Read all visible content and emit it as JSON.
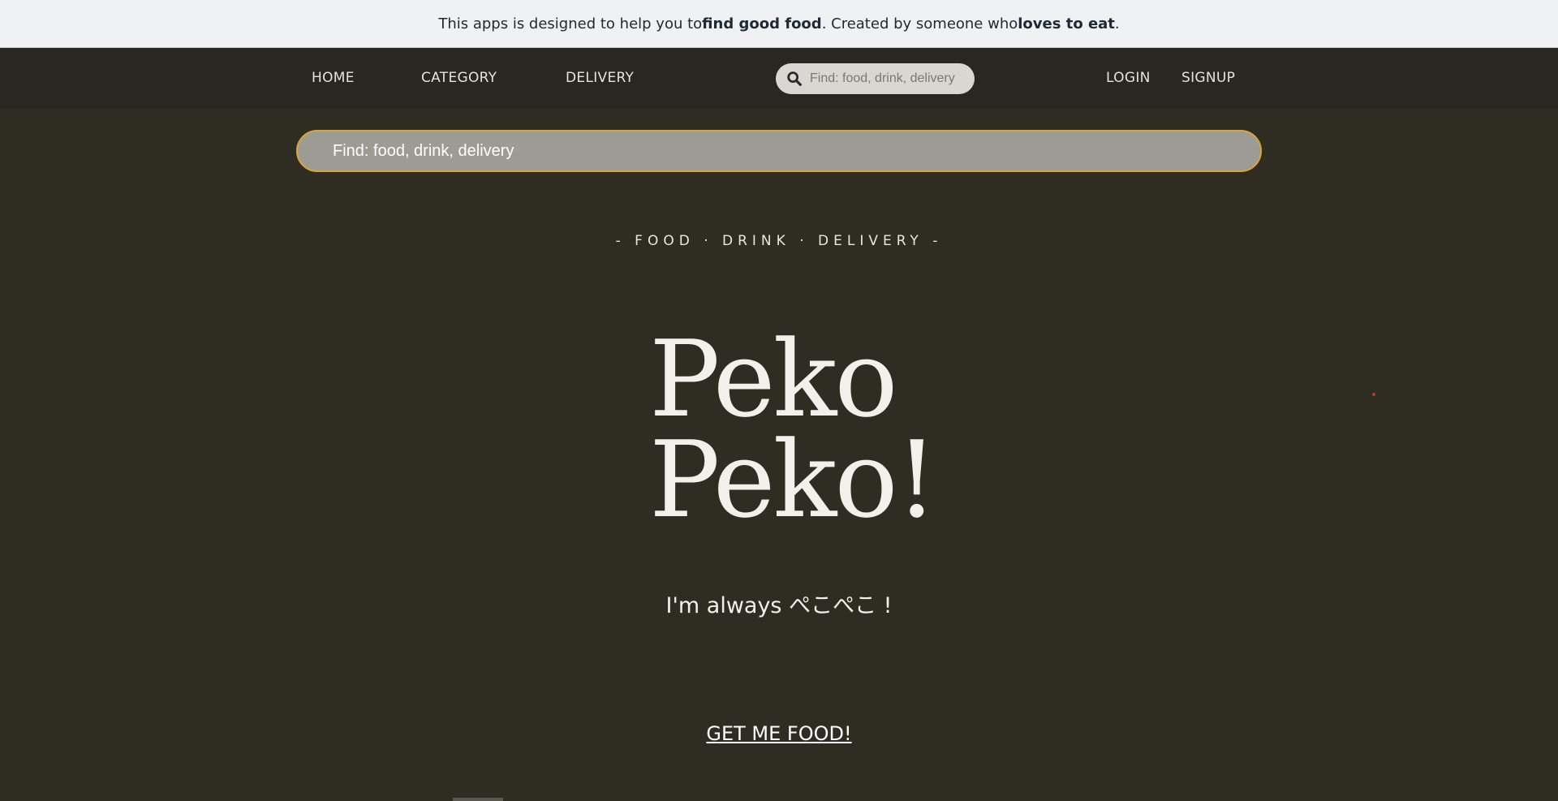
{
  "banner": {
    "part1": "This apps is designed to help you to ",
    "bold1": "find good food",
    "part2": ". Created by someone who ",
    "bold2": "loves to eat",
    "part3": "."
  },
  "nav": {
    "home": "HOME",
    "category": "CATEGORY",
    "delivery": "DELIVERY",
    "search_placeholder": "Find: food, drink, delivery",
    "login": "LOGIN",
    "signup": "SIGNUP"
  },
  "main_search": {
    "placeholder": "Find: food, drink, delivery"
  },
  "hero": {
    "tagline": "- FOOD · DRINK · DELIVERY -",
    "title_line1": "Peko",
    "title_line2": "Peko!",
    "subtitle": "I'm always ぺこぺこ !",
    "cta": "GET ME FOOD!"
  },
  "colors": {
    "background": "#2f2d22",
    "navbar": "#29271f",
    "banner": "#eff1f3",
    "search_border": "#d9a53a"
  }
}
